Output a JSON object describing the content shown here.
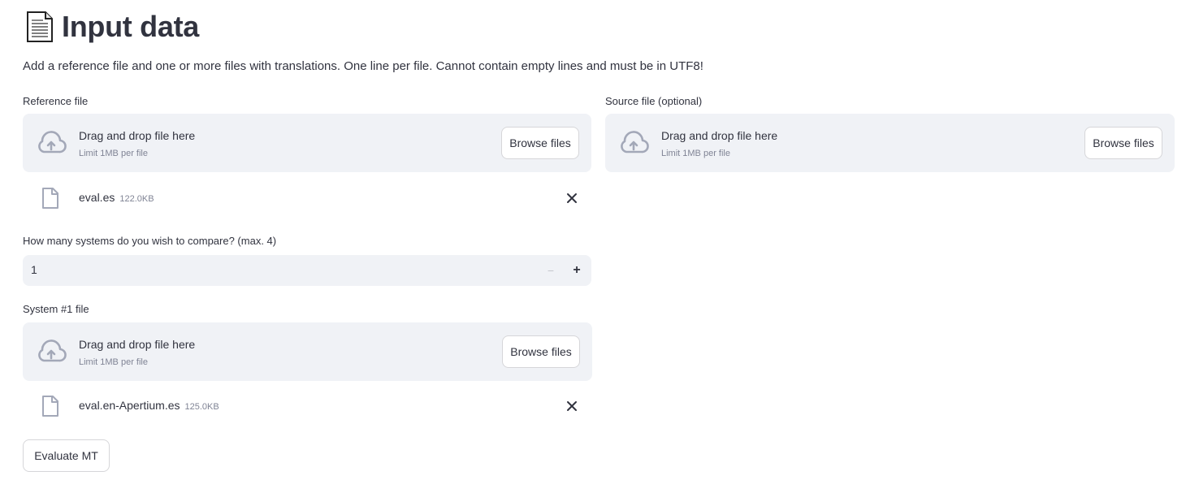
{
  "header": {
    "title": "Input data",
    "icon": "page-icon"
  },
  "description": "Add a reference file and one or more files with translations. One line per file. Cannot contain empty lines and must be in UTF8!",
  "reference": {
    "label": "Reference file",
    "drop_text": "Drag and drop file here",
    "limit_text": "Limit 1MB per file",
    "browse_label": "Browse files",
    "file": {
      "name": "eval.es",
      "size": "122.0KB"
    }
  },
  "source": {
    "label": "Source file (optional)",
    "drop_text": "Drag and drop file here",
    "limit_text": "Limit 1MB per file",
    "browse_label": "Browse files"
  },
  "systems": {
    "label": "How many systems do you wish to compare? (max. 4)",
    "value": "1",
    "minus": "−",
    "plus": "+"
  },
  "system1": {
    "label": "System #1 file",
    "drop_text": "Drag and drop file here",
    "limit_text": "Limit 1MB per file",
    "browse_label": "Browse files",
    "file": {
      "name": "eval.en-Apertium.es",
      "size": "125.0KB"
    }
  },
  "evaluate_label": "Evaluate MT",
  "colors": {
    "panel": "#f0f2f6",
    "text": "#31333f",
    "muted": "#808495",
    "icon": "#a3a8b8"
  }
}
